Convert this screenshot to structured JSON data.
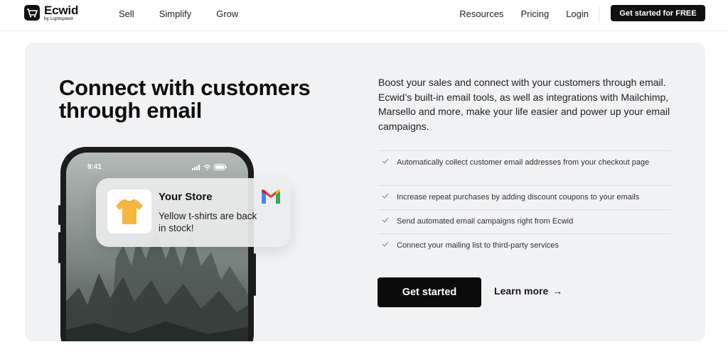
{
  "header": {
    "logo_name": "Ecwid",
    "logo_sub": "by Lightspeed",
    "nav_left": [
      "Sell",
      "Simplify",
      "Grow"
    ],
    "nav_right": [
      "Resources",
      "Pricing",
      "Login"
    ],
    "cta": "Get started for FREE"
  },
  "hero": {
    "headline": "Connect with customers through email",
    "intro": "Boost your sales and connect with your customers through email. Ecwid’s built-in email tools, as well as integrations with Mailchimp, Marsello and more, make your life easier and power up your email campaigns.",
    "features": [
      "Automatically collect customer email addresses from your checkout page",
      "Increase repeat purchases by adding discount coupons to your emails",
      "Send automated email campaigns right from Ecwid",
      "Connect your mailing list to third-party services"
    ],
    "primary_button": "Get started",
    "secondary_link": "Learn more",
    "secondary_arrow": "→"
  },
  "phone": {
    "time": "9:41",
    "notification": {
      "title": "Your Store",
      "body": "Yellow t-shirts are back in stock!",
      "app_icon": "gmail-icon",
      "thumb_icon": "tshirt-icon"
    }
  },
  "colors": {
    "brand_dark": "#111111",
    "card_bg": "#f1f2f4",
    "tshirt": "#f6b73c"
  }
}
